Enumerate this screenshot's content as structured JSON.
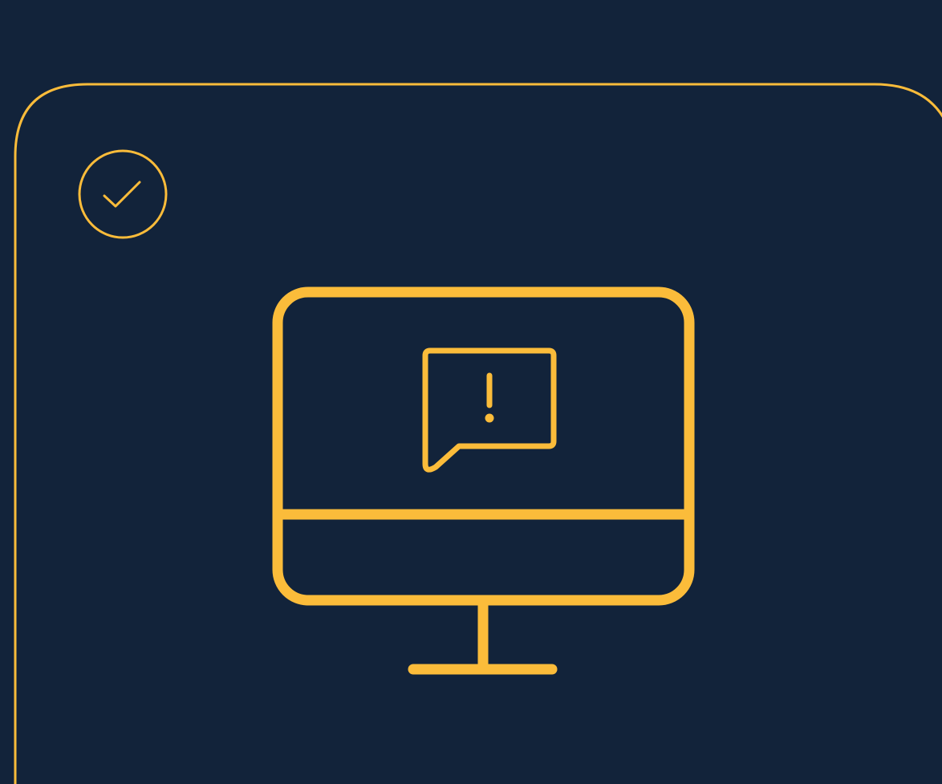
{
  "colors": {
    "background": "#12233a",
    "accent": "#fbbc3a"
  },
  "icons": {
    "status_badge": "check-circle-icon",
    "illustration": "monitor-alert-icon",
    "alert_bubble": "speech-bubble-exclamation-icon"
  },
  "status": {
    "checked": true
  }
}
